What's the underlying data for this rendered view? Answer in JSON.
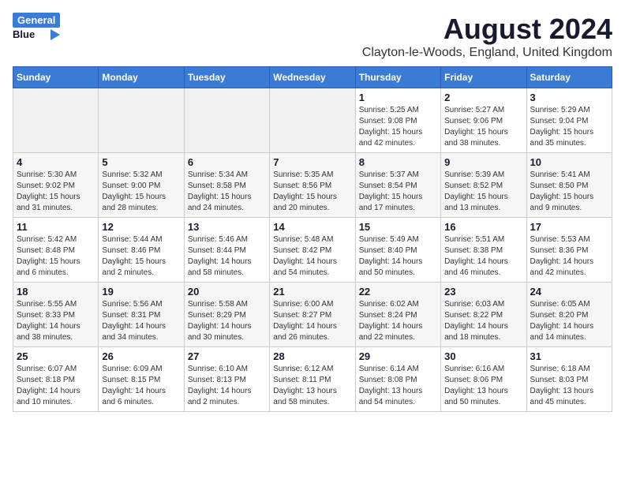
{
  "header": {
    "logo_general": "General",
    "logo_blue": "Blue",
    "title": "August 2024",
    "subtitle": "Clayton-le-Woods, England, United Kingdom"
  },
  "calendar": {
    "days_of_week": [
      "Sunday",
      "Monday",
      "Tuesday",
      "Wednesday",
      "Thursday",
      "Friday",
      "Saturday"
    ],
    "weeks": [
      [
        {
          "day": "",
          "content": ""
        },
        {
          "day": "",
          "content": ""
        },
        {
          "day": "",
          "content": ""
        },
        {
          "day": "",
          "content": ""
        },
        {
          "day": "1",
          "content": "Sunrise: 5:25 AM\nSunset: 9:08 PM\nDaylight: 15 hours\nand 42 minutes."
        },
        {
          "day": "2",
          "content": "Sunrise: 5:27 AM\nSunset: 9:06 PM\nDaylight: 15 hours\nand 38 minutes."
        },
        {
          "day": "3",
          "content": "Sunrise: 5:29 AM\nSunset: 9:04 PM\nDaylight: 15 hours\nand 35 minutes."
        }
      ],
      [
        {
          "day": "4",
          "content": "Sunrise: 5:30 AM\nSunset: 9:02 PM\nDaylight: 15 hours\nand 31 minutes."
        },
        {
          "day": "5",
          "content": "Sunrise: 5:32 AM\nSunset: 9:00 PM\nDaylight: 15 hours\nand 28 minutes."
        },
        {
          "day": "6",
          "content": "Sunrise: 5:34 AM\nSunset: 8:58 PM\nDaylight: 15 hours\nand 24 minutes."
        },
        {
          "day": "7",
          "content": "Sunrise: 5:35 AM\nSunset: 8:56 PM\nDaylight: 15 hours\nand 20 minutes."
        },
        {
          "day": "8",
          "content": "Sunrise: 5:37 AM\nSunset: 8:54 PM\nDaylight: 15 hours\nand 17 minutes."
        },
        {
          "day": "9",
          "content": "Sunrise: 5:39 AM\nSunset: 8:52 PM\nDaylight: 15 hours\nand 13 minutes."
        },
        {
          "day": "10",
          "content": "Sunrise: 5:41 AM\nSunset: 8:50 PM\nDaylight: 15 hours\nand 9 minutes."
        }
      ],
      [
        {
          "day": "11",
          "content": "Sunrise: 5:42 AM\nSunset: 8:48 PM\nDaylight: 15 hours\nand 6 minutes."
        },
        {
          "day": "12",
          "content": "Sunrise: 5:44 AM\nSunset: 8:46 PM\nDaylight: 15 hours\nand 2 minutes."
        },
        {
          "day": "13",
          "content": "Sunrise: 5:46 AM\nSunset: 8:44 PM\nDaylight: 14 hours\nand 58 minutes."
        },
        {
          "day": "14",
          "content": "Sunrise: 5:48 AM\nSunset: 8:42 PM\nDaylight: 14 hours\nand 54 minutes."
        },
        {
          "day": "15",
          "content": "Sunrise: 5:49 AM\nSunset: 8:40 PM\nDaylight: 14 hours\nand 50 minutes."
        },
        {
          "day": "16",
          "content": "Sunrise: 5:51 AM\nSunset: 8:38 PM\nDaylight: 14 hours\nand 46 minutes."
        },
        {
          "day": "17",
          "content": "Sunrise: 5:53 AM\nSunset: 8:36 PM\nDaylight: 14 hours\nand 42 minutes."
        }
      ],
      [
        {
          "day": "18",
          "content": "Sunrise: 5:55 AM\nSunset: 8:33 PM\nDaylight: 14 hours\nand 38 minutes."
        },
        {
          "day": "19",
          "content": "Sunrise: 5:56 AM\nSunset: 8:31 PM\nDaylight: 14 hours\nand 34 minutes."
        },
        {
          "day": "20",
          "content": "Sunrise: 5:58 AM\nSunset: 8:29 PM\nDaylight: 14 hours\nand 30 minutes."
        },
        {
          "day": "21",
          "content": "Sunrise: 6:00 AM\nSunset: 8:27 PM\nDaylight: 14 hours\nand 26 minutes."
        },
        {
          "day": "22",
          "content": "Sunrise: 6:02 AM\nSunset: 8:24 PM\nDaylight: 14 hours\nand 22 minutes."
        },
        {
          "day": "23",
          "content": "Sunrise: 6:03 AM\nSunset: 8:22 PM\nDaylight: 14 hours\nand 18 minutes."
        },
        {
          "day": "24",
          "content": "Sunrise: 6:05 AM\nSunset: 8:20 PM\nDaylight: 14 hours\nand 14 minutes."
        }
      ],
      [
        {
          "day": "25",
          "content": "Sunrise: 6:07 AM\nSunset: 8:18 PM\nDaylight: 14 hours\nand 10 minutes."
        },
        {
          "day": "26",
          "content": "Sunrise: 6:09 AM\nSunset: 8:15 PM\nDaylight: 14 hours\nand 6 minutes."
        },
        {
          "day": "27",
          "content": "Sunrise: 6:10 AM\nSunset: 8:13 PM\nDaylight: 14 hours\nand 2 minutes."
        },
        {
          "day": "28",
          "content": "Sunrise: 6:12 AM\nSunset: 8:11 PM\nDaylight: 13 hours\nand 58 minutes."
        },
        {
          "day": "29",
          "content": "Sunrise: 6:14 AM\nSunset: 8:08 PM\nDaylight: 13 hours\nand 54 minutes."
        },
        {
          "day": "30",
          "content": "Sunrise: 6:16 AM\nSunset: 8:06 PM\nDaylight: 13 hours\nand 50 minutes."
        },
        {
          "day": "31",
          "content": "Sunrise: 6:18 AM\nSunset: 8:03 PM\nDaylight: 13 hours\nand 45 minutes."
        }
      ]
    ]
  }
}
